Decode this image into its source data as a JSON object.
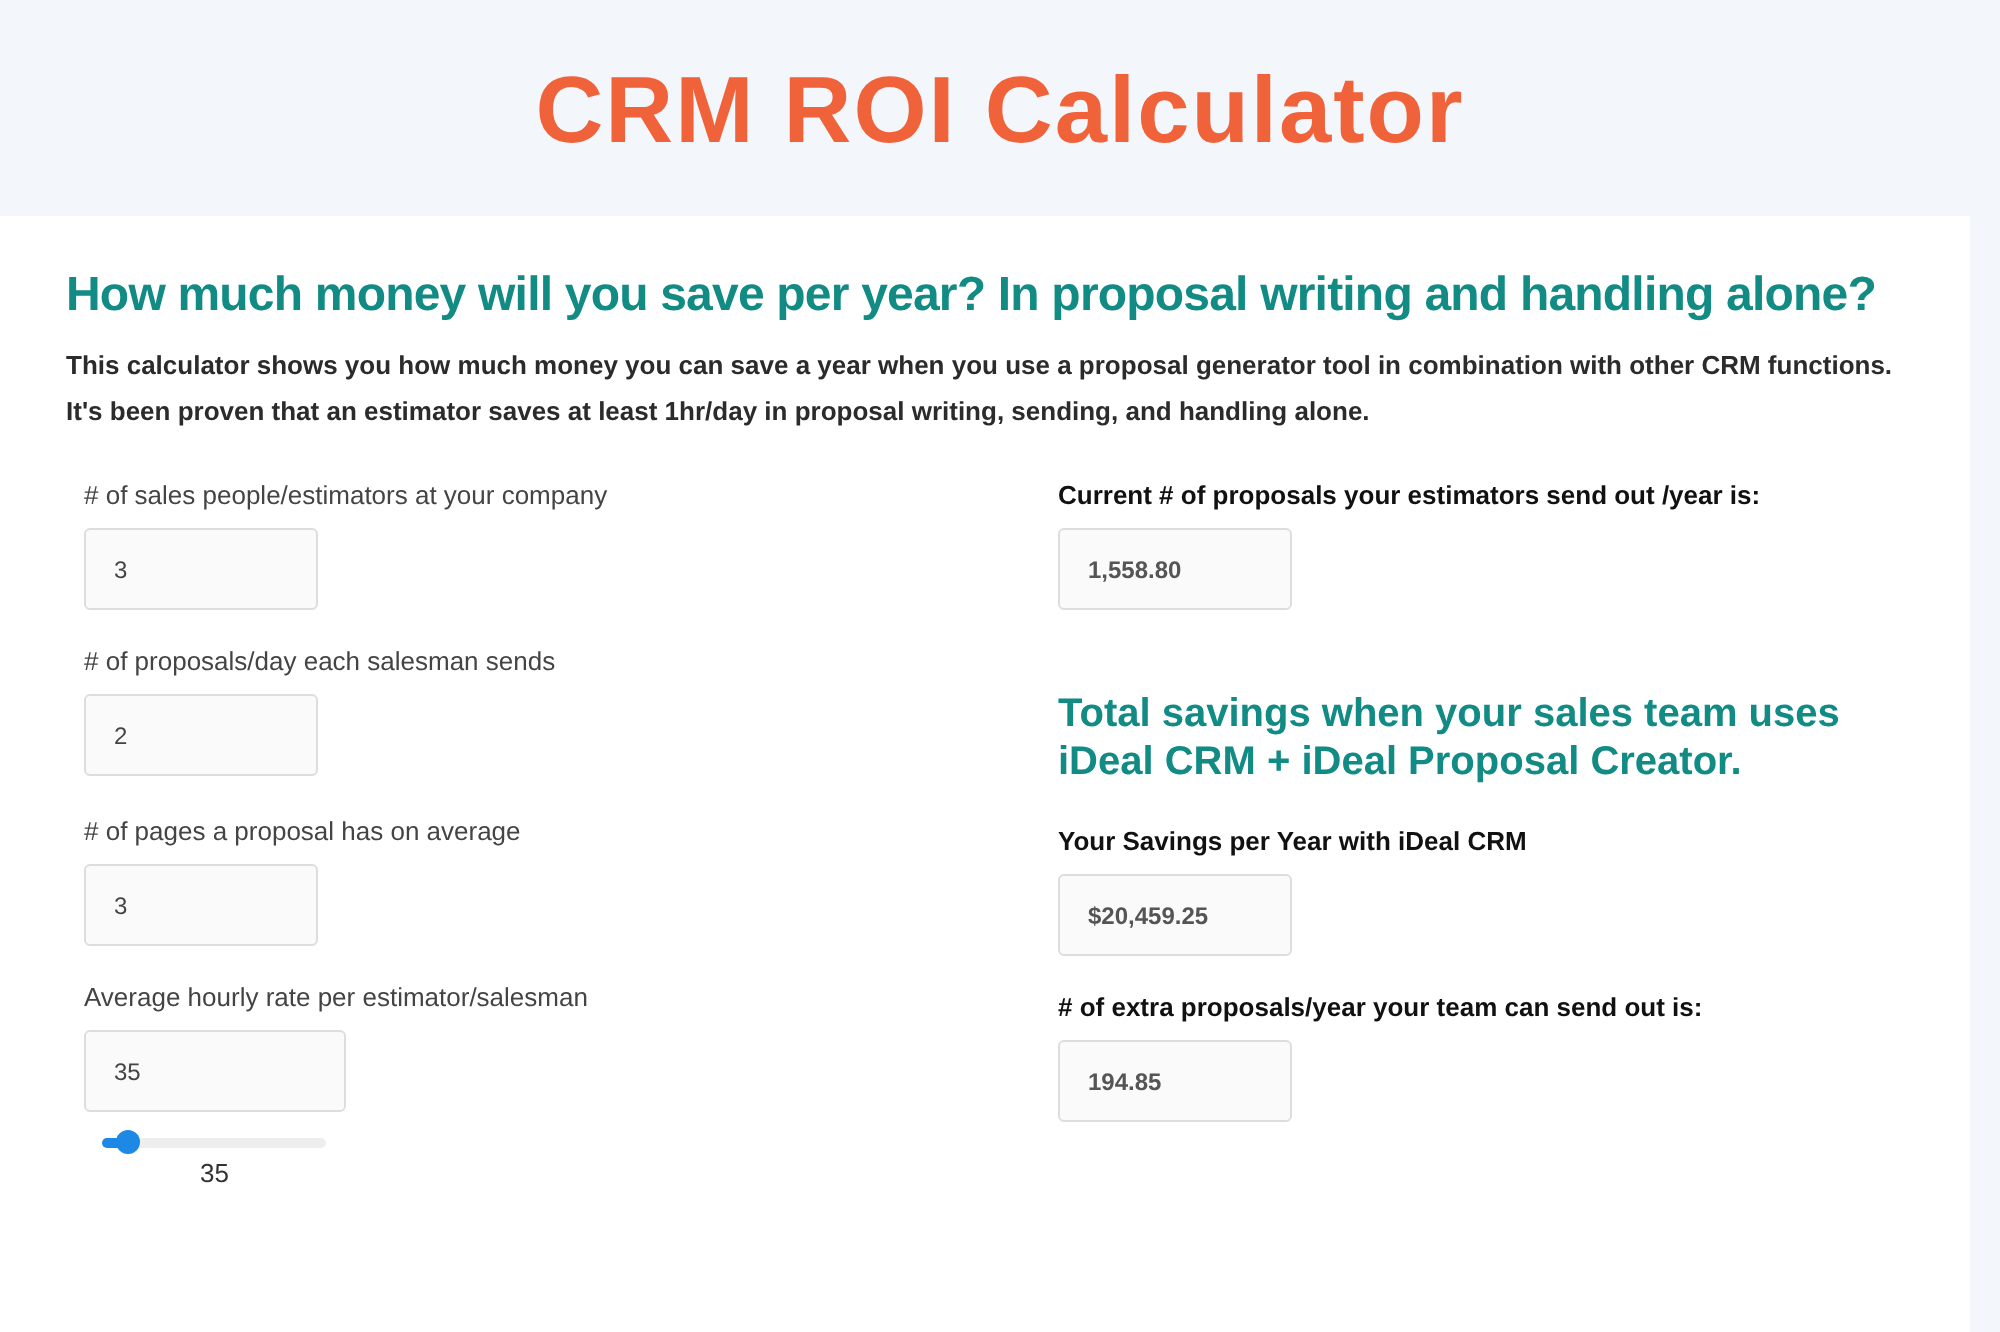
{
  "header": {
    "title": "CRM ROI Calculator"
  },
  "intro": {
    "heading": "How much money will you save per year? In proposal writing and handling alone?",
    "paragraphs": [
      "This calculator shows you how much money you can save a year when you use a proposal generator tool in combination with other CRM functions.",
      "It's been proven that an estimator saves at least 1hr/day in proposal writing, sending, and handling alone."
    ]
  },
  "inputs": [
    {
      "label": "# of sales people/estimators at your company",
      "value": "3"
    },
    {
      "label": "# of proposals/day each salesman sends",
      "value": "2"
    },
    {
      "label": "# of pages a proposal has on average",
      "value": "3"
    },
    {
      "label": "Average hourly rate per estimator/salesman",
      "value": "35",
      "slider": {
        "level": 0.12,
        "reading": "35"
      }
    }
  ],
  "results": [
    {
      "kind": "field",
      "label": "Current # of proposals your estimators send out /year is:",
      "value": "1,558.80"
    },
    {
      "kind": "heading",
      "text": "Total savings when your sales team uses iDeal CRM + iDeal Proposal Creator."
    },
    {
      "kind": "field",
      "label": "Your Savings per Year with iDeal CRM",
      "value": "$20,459.25"
    },
    {
      "kind": "field",
      "label": "# of extra proposals/year your team can send out is:",
      "value": "194.85"
    }
  ]
}
